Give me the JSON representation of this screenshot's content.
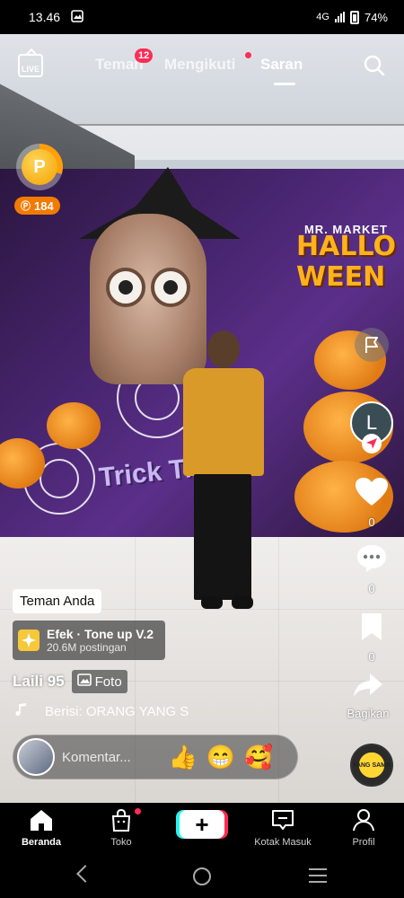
{
  "status_bar": {
    "time": "13.46",
    "network": "4G",
    "battery": "74%"
  },
  "top_nav": {
    "live_label": "LIVE",
    "tabs": [
      {
        "label": "Teman",
        "badge": "12"
      },
      {
        "label": "Mengikuti"
      },
      {
        "label": "Saran",
        "active": true
      }
    ]
  },
  "coins": {
    "amount": "184",
    "coin_letter": "P"
  },
  "scene_text": {
    "sign_small": "MR. MARKET",
    "sign_big": "HALLO WEEN",
    "trick": "Trick Treat"
  },
  "actions": {
    "avatar_letter": "L",
    "likes": "0",
    "comments": "0",
    "saves": "0",
    "share_label": "Bagikan"
  },
  "post": {
    "friend_tag": "Teman Anda",
    "effect_name": "Efek · Tone up V.2",
    "effect_posts": "20.6M postingan",
    "author": "Laili 95",
    "photo_badge": "Foto",
    "music": "Berisi: ORANG YANG S"
  },
  "comment_bar": {
    "placeholder": "Komentar...",
    "emojis": [
      "👍",
      "😁",
      "🥰"
    ]
  },
  "sound_disc_label": "YANG SAMA",
  "tab_bar": {
    "items": [
      "Beranda",
      "Toko",
      "Kotak Masuk",
      "Profil"
    ],
    "active": "Beranda"
  },
  "colors": {
    "accent_red": "#fe2c55",
    "accent_cyan": "#25f4ee",
    "coin_orange": "#f37a00"
  }
}
